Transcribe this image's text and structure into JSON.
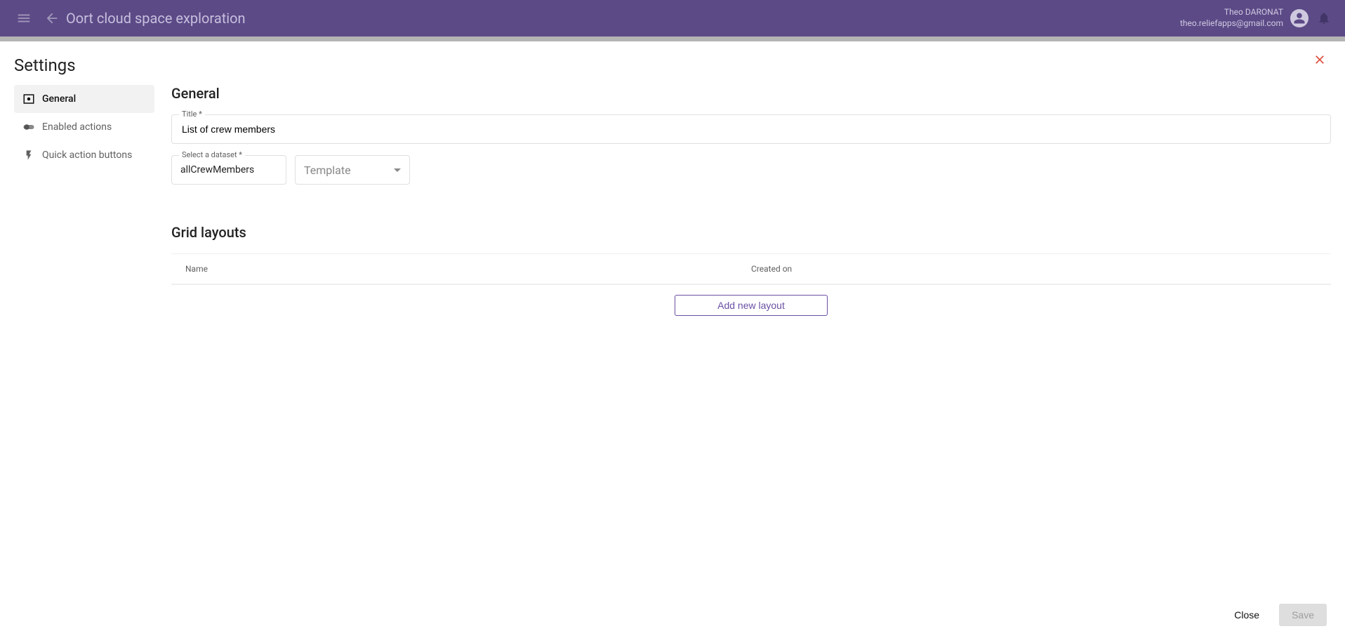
{
  "appbar": {
    "title": "Oort cloud space exploration",
    "user_name": "Theo DARONAT",
    "user_email": "theo.reliefapps@gmail.com"
  },
  "dialog": {
    "title": "Settings",
    "close_btn": "Close",
    "save_btn": "Save"
  },
  "sidebar": {
    "items": [
      {
        "label": "General"
      },
      {
        "label": "Enabled actions"
      },
      {
        "label": "Quick action buttons"
      }
    ]
  },
  "general": {
    "section_title": "General",
    "title_label": "Title *",
    "title_value": "List of crew members",
    "dataset_label": "Select a dataset *",
    "dataset_value": "allCrewMembers",
    "template_placeholder": "Template"
  },
  "grid": {
    "section_title": "Grid layouts",
    "col_name": "Name",
    "col_created": "Created on",
    "add_btn": "Add new layout"
  }
}
